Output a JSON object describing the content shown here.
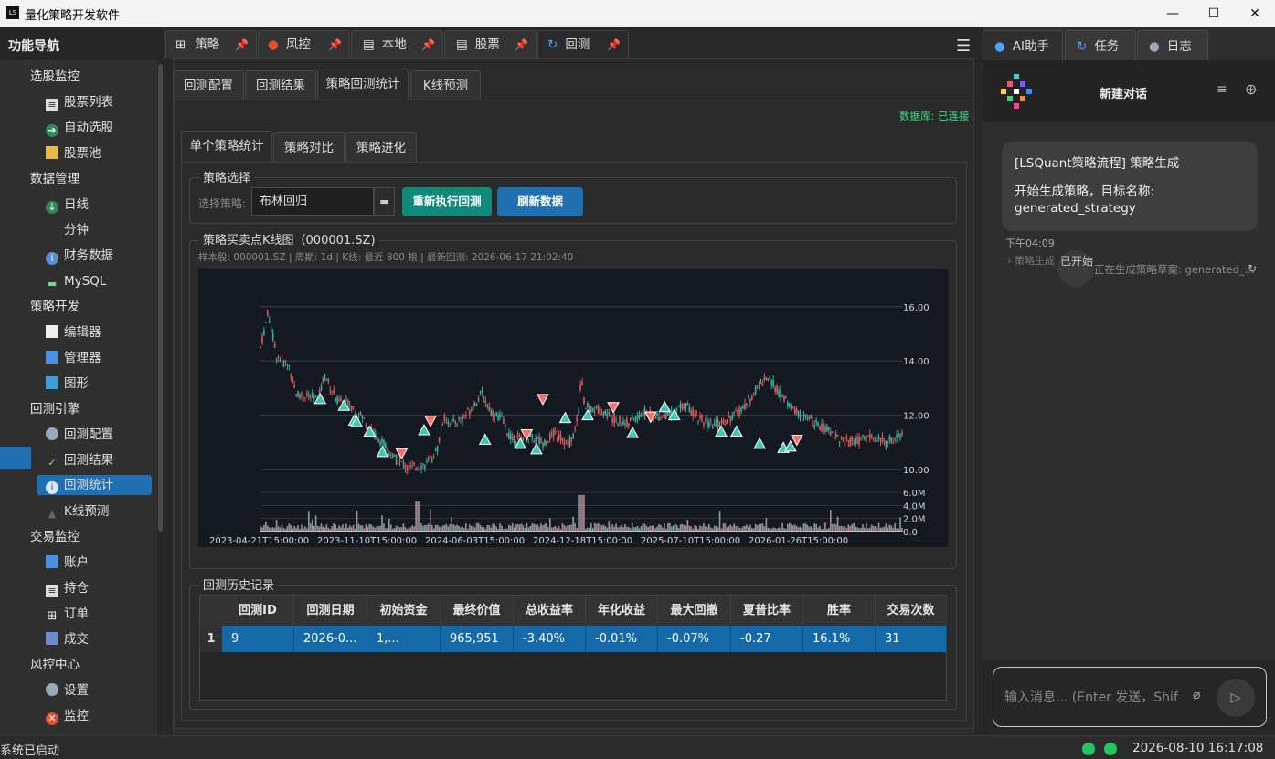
{
  "app": {
    "title": "量化策略开发软件"
  },
  "window": {
    "minimize": "—",
    "maximize": "☐",
    "close": "✕"
  },
  "sidebar": {
    "title": "功能导航",
    "groups": [
      {
        "label": "选股监控",
        "items": [
          {
            "label": "股票列表"
          },
          {
            "label": "自动选股"
          },
          {
            "label": "股票池"
          }
        ]
      },
      {
        "label": "数据管理",
        "items": [
          {
            "label": "日线"
          },
          {
            "label": "分钟"
          },
          {
            "label": "财务数据"
          },
          {
            "label": "MySQL"
          }
        ]
      },
      {
        "label": "策略开发",
        "items": [
          {
            "label": "编辑器"
          },
          {
            "label": "管理器"
          },
          {
            "label": "图形"
          }
        ]
      },
      {
        "label": "回测引擎",
        "items": [
          {
            "label": "回测配置"
          },
          {
            "label": "回测结果"
          },
          {
            "label": "回测统计"
          },
          {
            "label": "K线预测"
          }
        ]
      },
      {
        "label": "交易监控",
        "items": [
          {
            "label": "账户"
          },
          {
            "label": "持仓"
          },
          {
            "label": "订单"
          },
          {
            "label": "成交"
          }
        ]
      },
      {
        "label": "风控中心",
        "items": [
          {
            "label": "设置"
          },
          {
            "label": "监控"
          }
        ]
      }
    ]
  },
  "main_tabs": [
    {
      "label": "策略"
    },
    {
      "label": "风控"
    },
    {
      "label": "本地"
    },
    {
      "label": "股票"
    },
    {
      "label": "回测"
    }
  ],
  "backtest_tabs": [
    {
      "label": "回测配置"
    },
    {
      "label": "回测结果"
    },
    {
      "label": "策略回测统计"
    },
    {
      "label": "K线预测"
    }
  ],
  "db_status": "数据库: 已连接",
  "stat_tabs": [
    {
      "label": "单个策略统计"
    },
    {
      "label": "策略对比"
    },
    {
      "label": "策略进化"
    }
  ],
  "strategy_select": {
    "group_title": "策略选择",
    "label": "选择策略:",
    "value": "布林回归",
    "rerun_button": "重新执行回测",
    "refresh_button": "刷新数据"
  },
  "kline": {
    "group_title": "策略买卖点K线图（000001.SZ)",
    "subtitle": "样本股: 000001.SZ | 周期: 1d | K线: 最近 800 根 | 最新回测: 2026-06-17 21:02:40"
  },
  "chart_data": {
    "type": "candlestick",
    "symbol": "000001.SZ",
    "price_ylim": [
      9.5,
      16.8
    ],
    "price_ticks": [
      "16.00",
      "14.00",
      "12.00",
      "10.00"
    ],
    "volume_ticks": [
      "6.0M",
      "4.0M",
      "2.0M",
      "0.0"
    ],
    "x_ticks": [
      "2023-04-21T15:00:00",
      "2023-11-10T15:00:00",
      "2024-06-03T15:00:00",
      "2024-12-18T15:00:00",
      "2025-07-10T15:00:00",
      "2026-01-26T15:00:00"
    ],
    "colors": {
      "up": "#e05a5a",
      "down": "#2fb5a3",
      "buy": "#3fc7b2",
      "sell": "#ff6b6b",
      "grid": "#3a3f4a",
      "bg": "#141820"
    },
    "price_path": [
      [
        0,
        14.5
      ],
      [
        0.012,
        15.8
      ],
      [
        0.025,
        14.2
      ],
      [
        0.045,
        13.8
      ],
      [
        0.055,
        12.8
      ],
      [
        0.09,
        12.6
      ],
      [
        0.1,
        13.5
      ],
      [
        0.12,
        12.5
      ],
      [
        0.14,
        12.4
      ],
      [
        0.16,
        11.9
      ],
      [
        0.17,
        11.5
      ],
      [
        0.19,
        11.0
      ],
      [
        0.205,
        10.5
      ],
      [
        0.23,
        10.05
      ],
      [
        0.26,
        10.2
      ],
      [
        0.275,
        10.7
      ],
      [
        0.285,
        11.9
      ],
      [
        0.3,
        11.7
      ],
      [
        0.32,
        12.0
      ],
      [
        0.345,
        12.8
      ],
      [
        0.36,
        12.1
      ],
      [
        0.375,
        11.9
      ],
      [
        0.39,
        11.15
      ],
      [
        0.42,
        11.2
      ],
      [
        0.44,
        11.0
      ],
      [
        0.46,
        11.35
      ],
      [
        0.48,
        10.9
      ],
      [
        0.49,
        11.4
      ],
      [
        0.495,
        12.0
      ],
      [
        0.5,
        13.5
      ],
      [
        0.505,
        12.3
      ],
      [
        0.53,
        12.2
      ],
      [
        0.55,
        11.9
      ],
      [
        0.57,
        11.7
      ],
      [
        0.6,
        12.1
      ],
      [
        0.62,
        11.95
      ],
      [
        0.645,
        12.1
      ],
      [
        0.66,
        12.4
      ],
      [
        0.68,
        12.0
      ],
      [
        0.7,
        11.6
      ],
      [
        0.72,
        11.75
      ],
      [
        0.74,
        12.0
      ],
      [
        0.76,
        12.5
      ],
      [
        0.78,
        13.2
      ],
      [
        0.79,
        13.4
      ],
      [
        0.81,
        12.8
      ],
      [
        0.83,
        12.2
      ],
      [
        0.85,
        11.9
      ],
      [
        0.87,
        11.6
      ],
      [
        0.89,
        11.4
      ],
      [
        0.91,
        11.0
      ],
      [
        0.93,
        11.05
      ],
      [
        0.95,
        11.2
      ],
      [
        0.975,
        11.0
      ],
      [
        1,
        11.3
      ]
    ],
    "signals": [
      {
        "t": 0.093,
        "price": 12.6,
        "type": "buy"
      },
      {
        "t": 0.13,
        "price": 12.35,
        "type": "buy"
      },
      {
        "t": 0.146,
        "price": 11.8,
        "type": "buy"
      },
      {
        "t": 0.15,
        "price": 11.75,
        "type": "buy"
      },
      {
        "t": 0.17,
        "price": 11.4,
        "type": "buy"
      },
      {
        "t": 0.19,
        "price": 10.65,
        "type": "buy"
      },
      {
        "t": 0.22,
        "price": 10.6,
        "type": "sell"
      },
      {
        "t": 0.255,
        "price": 11.45,
        "type": "buy"
      },
      {
        "t": 0.265,
        "price": 11.8,
        "type": "sell"
      },
      {
        "t": 0.35,
        "price": 11.1,
        "type": "buy"
      },
      {
        "t": 0.405,
        "price": 10.95,
        "type": "buy"
      },
      {
        "t": 0.415,
        "price": 11.3,
        "type": "sell"
      },
      {
        "t": 0.43,
        "price": 10.75,
        "type": "buy"
      },
      {
        "t": 0.44,
        "price": 12.6,
        "type": "sell"
      },
      {
        "t": 0.475,
        "price": 11.9,
        "type": "buy"
      },
      {
        "t": 0.51,
        "price": 12.0,
        "type": "buy"
      },
      {
        "t": 0.55,
        "price": 12.3,
        "type": "sell"
      },
      {
        "t": 0.58,
        "price": 11.35,
        "type": "buy"
      },
      {
        "t": 0.608,
        "price": 11.95,
        "type": "sell"
      },
      {
        "t": 0.63,
        "price": 12.3,
        "type": "buy"
      },
      {
        "t": 0.645,
        "price": 12.0,
        "type": "buy"
      },
      {
        "t": 0.718,
        "price": 11.4,
        "type": "buy"
      },
      {
        "t": 0.742,
        "price": 11.4,
        "type": "buy"
      },
      {
        "t": 0.778,
        "price": 10.95,
        "type": "buy"
      },
      {
        "t": 0.815,
        "price": 10.8,
        "type": "buy"
      },
      {
        "t": 0.826,
        "price": 10.85,
        "type": "buy"
      },
      {
        "t": 0.836,
        "price": 11.1,
        "type": "sell"
      }
    ]
  },
  "history": {
    "group_title": "回测历史记录",
    "columns": [
      "回测ID",
      "回测日期",
      "初始资金",
      "最终价值",
      "总收益率",
      "年化收益",
      "最大回撤",
      "夏普比率",
      "胜率",
      "交易次数"
    ],
    "rows": [
      {
        "index": "1",
        "cells": [
          "9",
          "2026-0...",
          "1,...",
          "965,951",
          "-3.40%",
          "-0.01%",
          "-0.07%",
          "-0.27",
          "16.1%",
          "31"
        ]
      }
    ]
  },
  "right_tabs": [
    {
      "label": "AI助手"
    },
    {
      "label": "任务"
    },
    {
      "label": "日志"
    }
  ],
  "chat": {
    "title": "新建对话",
    "message_line1": "[LSQuant策略流程] 策略生成",
    "message_line2": "开始生成策略，目标名称:",
    "message_line3": "generated_strategy",
    "time": "下午04:09",
    "step_label": "› 策略生成",
    "step_badge": "已开始",
    "step_text": "正在生成策略草案: generated_...",
    "input_placeholder": "输入消息... (Enter 发送，Shift+Enter 换行)"
  },
  "status": {
    "text": "系统已启动",
    "clock": "2026-08-10 16:17:08"
  }
}
